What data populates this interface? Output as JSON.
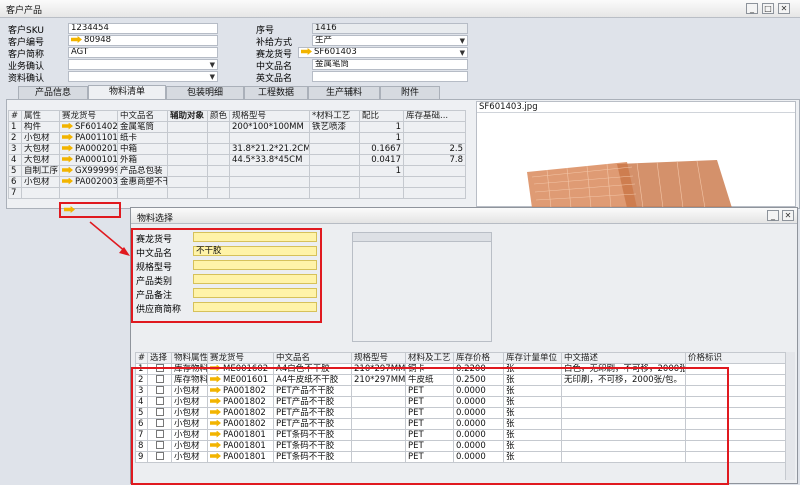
{
  "window": {
    "title": "客户产品",
    "btn_min": "_",
    "btn_max": "□",
    "btn_close": "✕"
  },
  "header": {
    "sku_label": "客户SKU",
    "sku_value": "1234454",
    "code_label": "客户编号",
    "code_value": "80948",
    "short_label": "客户简称",
    "short_value": "AGT",
    "biz_label": "业务确认",
    "biz_value": "",
    "doc_label": "资料确认",
    "doc_value": "",
    "seq_label": "序号",
    "seq_value": "1416",
    "supply_label": "补给方式",
    "supply_value": "生产",
    "sailong_label": "赛龙货号",
    "sailong_value": "SF601403",
    "cn_label": "中文品名",
    "cn_value": "金属笔筒",
    "en_label": "英文品名",
    "en_value": ""
  },
  "tabs": [
    "产品信息",
    "物料清单",
    "包装明细",
    "工程数据",
    "生产辅料",
    "附件"
  ],
  "bom": {
    "columns": [
      "#",
      "属性",
      "赛龙货号",
      "中文品名",
      "辅助对象",
      "颜色",
      "规格型号",
      "*材料工艺",
      "配比",
      "库存基础..."
    ],
    "rows": [
      [
        "1",
        "构件",
        "SF601402",
        "金属笔筒",
        "",
        "",
        "200*100*100MM",
        "铁艺喷漆",
        "1",
        ""
      ],
      [
        "2",
        "小包材",
        "PA001101",
        "纸卡",
        "",
        "",
        "",
        "",
        "1",
        ""
      ],
      [
        "3",
        "大包材",
        "PA000201",
        "中箱",
        "",
        "",
        "31.8*21.2*21.2CM",
        "",
        "0.1667",
        "2.5"
      ],
      [
        "4",
        "大包材",
        "PA000101",
        "外箱",
        "",
        "",
        "44.5*33.8*45CM",
        "",
        "0.0417",
        "7.8"
      ],
      [
        "5",
        "自制工序",
        "GX999999",
        "产品总包装",
        "",
        "",
        "",
        "",
        "1",
        ""
      ],
      [
        "6",
        "小包材",
        "PA002003",
        "金惠商塑不干",
        "",
        "",
        "",
        "",
        "",
        ""
      ],
      [
        "7",
        "",
        "",
        "",
        "",
        "",
        "",
        "",
        "",
        ""
      ]
    ]
  },
  "image": {
    "filename": "SF601403.jpg"
  },
  "dialog": {
    "title": "物料选择",
    "fields": [
      {
        "label": "赛龙货号",
        "value": ""
      },
      {
        "label": "中文品名",
        "value": "不干胶"
      },
      {
        "label": "规格型号",
        "value": ""
      },
      {
        "label": "产品类别",
        "value": ""
      },
      {
        "label": "产品备注",
        "value": ""
      },
      {
        "label": "供应商简称",
        "value": ""
      }
    ],
    "columns": [
      "#",
      "选择",
      "物料属性",
      "赛龙货号",
      "中文品名",
      "规格型号",
      "材料及工艺",
      "库存价格",
      "库存计量单位",
      "中文描述",
      "价格标识"
    ],
    "rows": [
      [
        "1",
        "",
        "库存物料",
        "ME001602",
        "A4白色不干胶",
        "210*297MM",
        "铜卡",
        "0.2200",
        "张",
        "白色，无印刷，不可移，2000张/",
        ""
      ],
      [
        "2",
        "",
        "库存物料",
        "ME001601",
        "A4牛皮纸不干胶",
        "210*297MM",
        "牛皮纸",
        "0.2500",
        "张",
        "无印刷，不可移，2000张/包。",
        ""
      ],
      [
        "3",
        "",
        "小包材",
        "PA001802",
        "PET产品不干胶",
        "",
        "PET",
        "0.0000",
        "张",
        "",
        ""
      ],
      [
        "4",
        "",
        "小包材",
        "PA001802",
        "PET产品不干胶",
        "",
        "PET",
        "0.0000",
        "张",
        "",
        ""
      ],
      [
        "5",
        "",
        "小包材",
        "PA001802",
        "PET产品不干胶",
        "",
        "PET",
        "0.0000",
        "张",
        "",
        ""
      ],
      [
        "6",
        "",
        "小包材",
        "PA001802",
        "PET产品不干胶",
        "",
        "PET",
        "0.0000",
        "张",
        "",
        ""
      ],
      [
        "7",
        "",
        "小包材",
        "PA001801",
        "PET条码不干胶",
        "",
        "PET",
        "0.0000",
        "张",
        "",
        ""
      ],
      [
        "8",
        "",
        "小包材",
        "PA001801",
        "PET条码不干胶",
        "",
        "PET",
        "0.0000",
        "张",
        "",
        ""
      ],
      [
        "9",
        "",
        "小包材",
        "PA001801",
        "PET条码不干胶",
        "",
        "PET",
        "0.0000",
        "张",
        "",
        ""
      ]
    ]
  },
  "colors": {
    "highlight": "#e0191f",
    "arrow": "#f2b400",
    "field_yellow": "#fff3a8"
  }
}
